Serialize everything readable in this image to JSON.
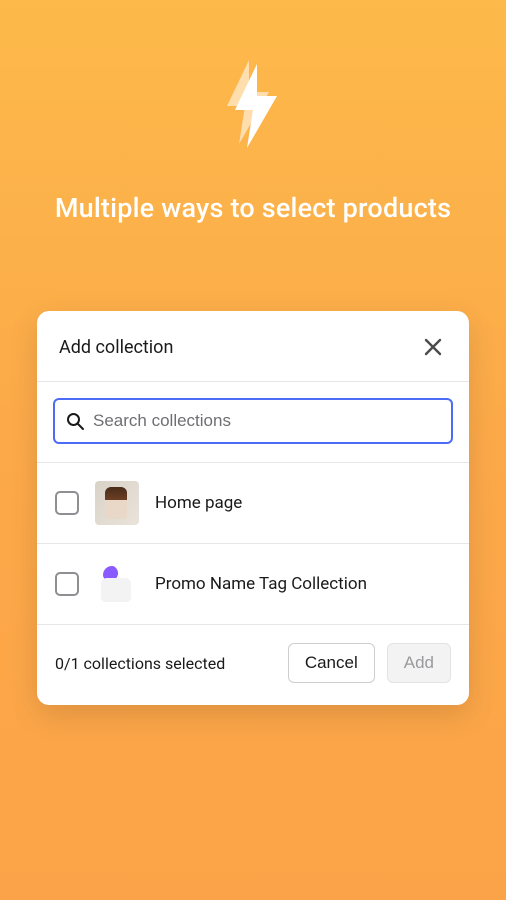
{
  "hero": {
    "headline": "Multiple ways to select products"
  },
  "modal": {
    "title": "Add collection",
    "search": {
      "placeholder": "Search collections",
      "value": ""
    },
    "items": [
      {
        "label": "Home page",
        "thumbClass": "home"
      },
      {
        "label": "Promo Name Tag Collection",
        "thumbClass": "promo"
      }
    ],
    "footer": {
      "selected_text": "0/1 collections selected",
      "cancel_label": "Cancel",
      "add_label": "Add"
    }
  },
  "icons": {
    "bolt": "bolt-icon",
    "close": "close-icon",
    "search": "search-icon"
  }
}
